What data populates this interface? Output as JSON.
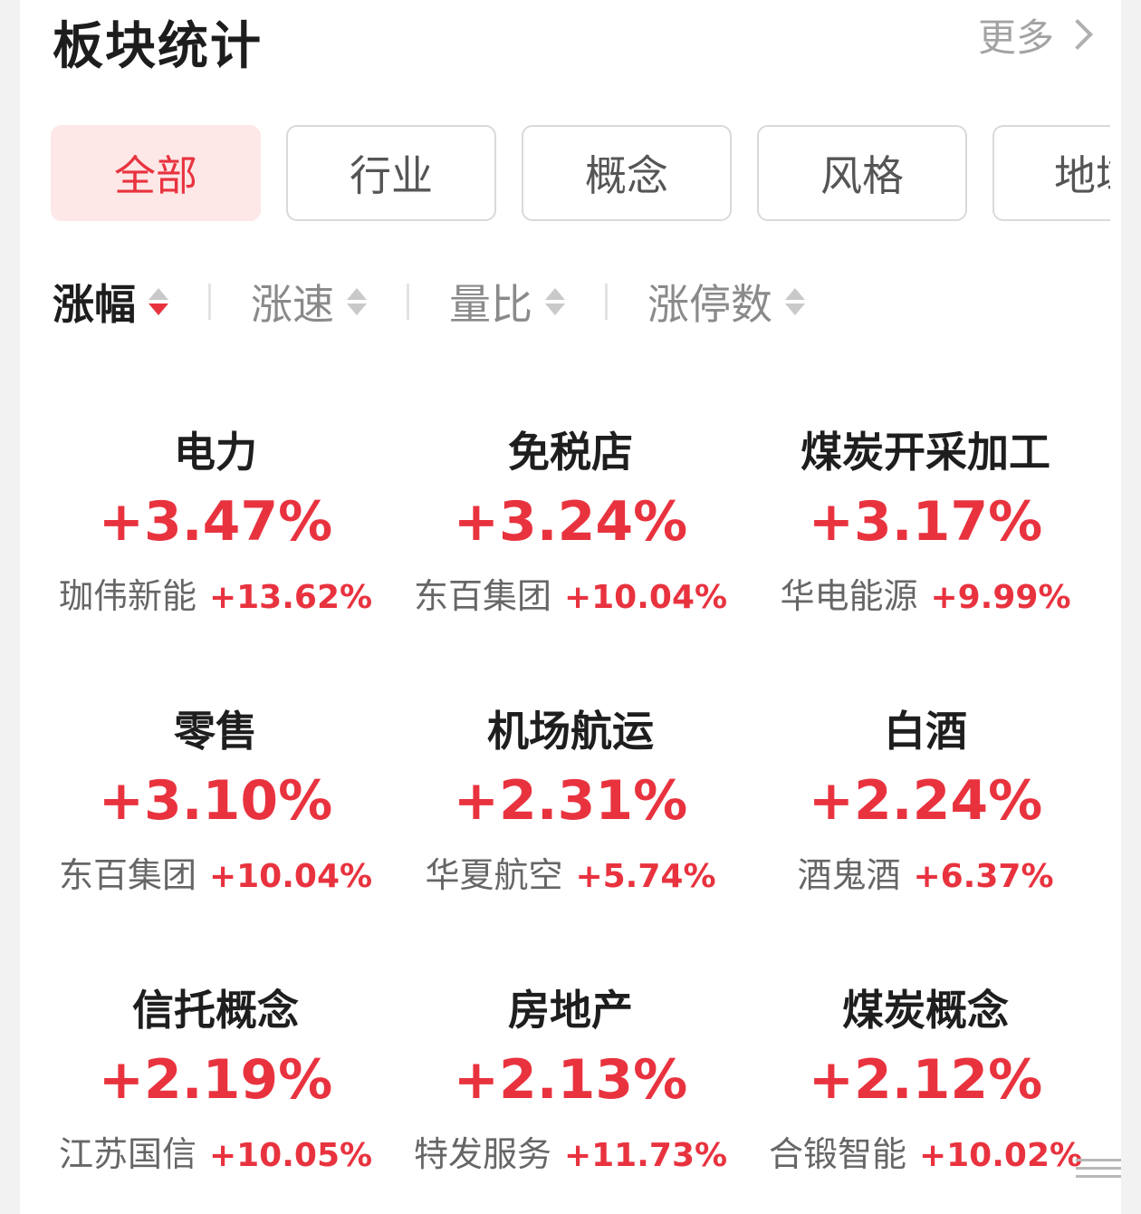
{
  "header": {
    "title": "板块统计",
    "more_label": "更多"
  },
  "tabs": [
    {
      "label": "全部",
      "active": true
    },
    {
      "label": "行业",
      "active": false
    },
    {
      "label": "概念",
      "active": false
    },
    {
      "label": "风格",
      "active": false
    },
    {
      "label": "地域",
      "active": false
    }
  ],
  "sorts": [
    {
      "label": "涨幅",
      "active": true,
      "direction": "desc"
    },
    {
      "label": "涨速",
      "active": false
    },
    {
      "label": "量比",
      "active": false
    },
    {
      "label": "涨停数",
      "active": false
    }
  ],
  "sectors": [
    {
      "name": "电力",
      "change": "+3.47%",
      "leader": "珈伟新能",
      "leader_change": "+13.62%"
    },
    {
      "name": "免税店",
      "change": "+3.24%",
      "leader": "东百集团",
      "leader_change": "+10.04%"
    },
    {
      "name": "煤炭开采加工",
      "change": "+3.17%",
      "leader": "华电能源",
      "leader_change": "+9.99%"
    },
    {
      "name": "零售",
      "change": "+3.10%",
      "leader": "东百集团",
      "leader_change": "+10.04%"
    },
    {
      "name": "机场航运",
      "change": "+2.31%",
      "leader": "华夏航空",
      "leader_change": "+5.74%"
    },
    {
      "name": "白酒",
      "change": "+2.24%",
      "leader": "酒鬼酒",
      "leader_change": "+6.37%"
    },
    {
      "name": "信托概念",
      "change": "+2.19%",
      "leader": "江苏国信",
      "leader_change": "+10.05%"
    },
    {
      "name": "房地产",
      "change": "+2.13%",
      "leader": "特发服务",
      "leader_change": "+11.73%"
    },
    {
      "name": "煤炭概念",
      "change": "+2.12%",
      "leader": "合锻智能",
      "leader_change": "+10.02%"
    }
  ],
  "colors": {
    "up": "#e8333f",
    "active_tab_bg": "#fde7e7"
  },
  "icons": {
    "more": "chevron-right-icon",
    "sort": "sort-arrows-icon"
  }
}
